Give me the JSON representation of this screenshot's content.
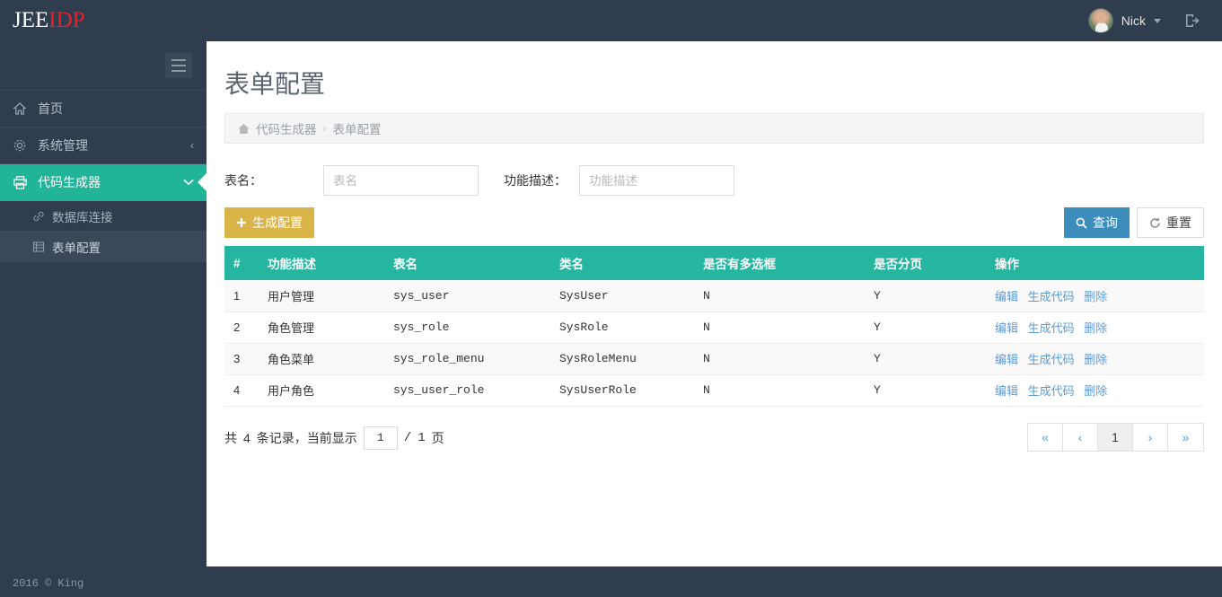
{
  "brand": {
    "part1": "JEE",
    "part2": "IDP",
    "color1": "#ffffff",
    "color2": "#e8202a"
  },
  "topbar": {
    "user_name": "Nick",
    "avatar_name": "user-avatar",
    "caret_icon": "chevron-down-icon",
    "logout_icon": "logout-icon"
  },
  "sidebar": {
    "toggle_icon": "hamburger-icon",
    "items": [
      {
        "label": "首页",
        "icon": "home-icon",
        "right": "",
        "active": false
      },
      {
        "label": "系统管理",
        "icon": "gear-icon",
        "right": "‹",
        "active": false
      },
      {
        "label": "代码生成器",
        "icon": "printer-icon",
        "right": "⌄",
        "active": true
      }
    ],
    "subitems": [
      {
        "label": "数据库连接",
        "icon": "link-icon",
        "selected": false
      },
      {
        "label": "表单配置",
        "icon": "table-icon",
        "selected": true
      }
    ],
    "footer": "2016 © King",
    "accent_color": "#21b499",
    "bg_color": "#2f3d4f"
  },
  "page": {
    "title": "表单配置",
    "breadcrumb": {
      "home_icon": "home-icon",
      "parent": "代码生成器",
      "separator": "›",
      "current": "表单配置"
    }
  },
  "filters": {
    "table_name": {
      "label": "表名：",
      "value": "",
      "placeholder": "表名"
    },
    "func_desc": {
      "label": "功能描述：",
      "value": "",
      "placeholder": "功能描述"
    }
  },
  "buttons": {
    "generate": {
      "label": "生成配置",
      "icon": "plus-icon",
      "color": "#d9b449"
    },
    "search": {
      "label": "查询",
      "icon": "search-icon",
      "color": "#3c8dbc"
    },
    "reset": {
      "label": "重置",
      "icon": "refresh-icon",
      "color": "#ffffff"
    }
  },
  "table": {
    "header_color": "#26b5a0",
    "columns": [
      "#",
      "功能描述",
      "表名",
      "类名",
      "是否有多选框",
      "是否分页",
      "操作"
    ],
    "rows": [
      {
        "num": "1",
        "desc": "用户管理",
        "table": "sys_user",
        "clazz": "SysUser",
        "multi": "N",
        "paged": "Y"
      },
      {
        "num": "2",
        "desc": "角色管理",
        "table": "sys_role",
        "clazz": "SysRole",
        "multi": "N",
        "paged": "Y"
      },
      {
        "num": "3",
        "desc": "角色菜单",
        "table": "sys_role_menu",
        "clazz": "SysRoleMenu",
        "multi": "N",
        "paged": "Y"
      },
      {
        "num": "4",
        "desc": "用户角色",
        "table": "sys_user_role",
        "clazz": "SysUserRole",
        "multi": "N",
        "paged": "Y"
      }
    ],
    "actions": {
      "edit": "编辑",
      "generate": "生成代码",
      "delete": "删除"
    }
  },
  "pagination": {
    "prefix": "共",
    "total": "4",
    "middle": "条记录，当前显示",
    "current_page": "1",
    "slash": "/",
    "total_pages": "1",
    "suffix": "页",
    "buttons": [
      "«",
      "‹",
      "1",
      "›",
      "»"
    ],
    "active_button_index": 2
  }
}
